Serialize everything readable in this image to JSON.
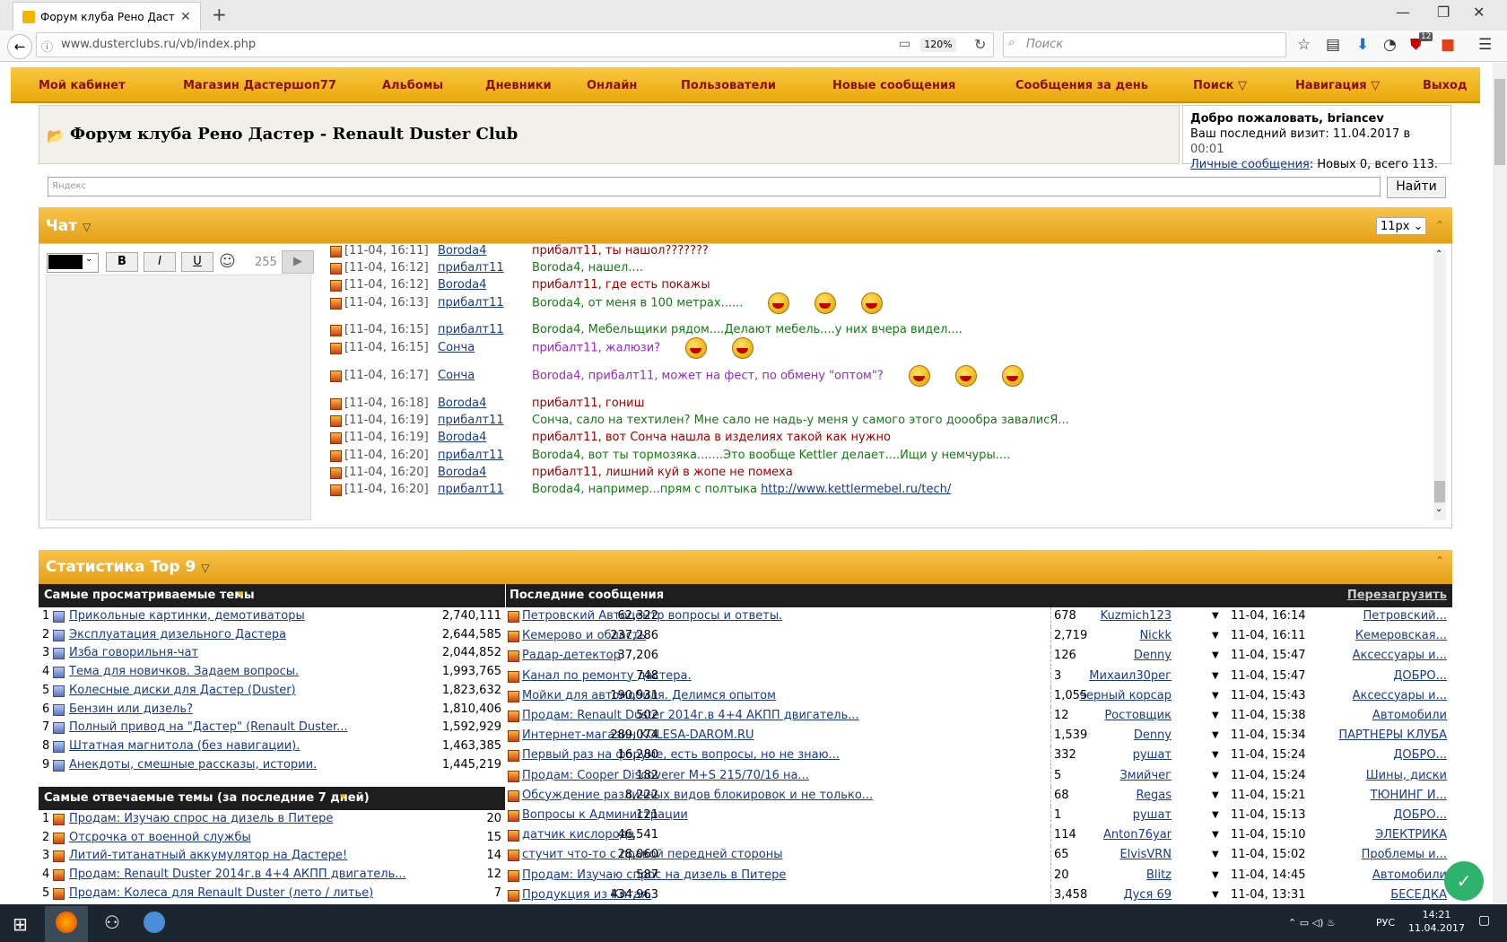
{
  "browser": {
    "tab_title": "Форум клуба Рено Дастер",
    "url": "www.dusterclubs.ru/vb/index.php",
    "zoom": "120%",
    "search_placeholder": "Поиск",
    "badge": "12"
  },
  "nav": {
    "items": [
      "Мой кабинет",
      "Магазин Дастершоп77",
      "Альбомы",
      "Дневники",
      "Онлайн",
      "Пользователи",
      "Новые сообщения",
      "Сообщения за день",
      "Поиск",
      "Навигация",
      "Выход"
    ]
  },
  "header": {
    "forum_title": "Форум клуба Рено Дастер - Renault Duster Club",
    "welcome_line": "Добро пожаловать, briancev",
    "last_visit_label": "Ваш последний визит: 11.04.2017 в",
    "last_visit_time": "00:01",
    "pm_link": "Личные сообщения",
    "pm_status": ": Новых 0, всего 113."
  },
  "search": {
    "placeholder": "Яндекс",
    "button": "Найти"
  },
  "chat": {
    "title": "Чат",
    "font_size": "11px",
    "char_count": "255",
    "bold": "B",
    "italic": "I",
    "underline": "U",
    "messages": [
      {
        "ts": "[11-04, 16:11]",
        "user": "Boroda4",
        "text": "прибалт11, ты нашол???????",
        "color": "#a00000",
        "smiles": 0
      },
      {
        "ts": "[11-04, 16:12]",
        "user": "прибалт11",
        "text": "Boroda4, нашел....",
        "color": "#157a15",
        "smiles": 0
      },
      {
        "ts": "[11-04, 16:12]",
        "user": "Boroda4",
        "text": "прибалт11, где есть покажы",
        "color": "#a00000",
        "smiles": 0
      },
      {
        "ts": "[11-04, 16:13]",
        "user": "прибалт11",
        "text": "Boroda4, от меня в 100 метрах......",
        "color": "#157a15",
        "smiles": 3
      },
      {
        "ts": "[11-04, 16:15]",
        "user": "прибалт11",
        "text": "Boroda4, Мебельщики рядом....Делают мебель....у них вчера видел....",
        "color": "#157a15",
        "smiles": 0
      },
      {
        "ts": "[11-04, 16:15]",
        "user": "Сонча",
        "text": "прибалт11, жалюзи?",
        "color": "#9a28c8",
        "smiles": 2
      },
      {
        "ts": "[11-04, 16:17]",
        "user": "Сонча",
        "text": "Boroda4, прибалт11, может на фест, по обмену \"оптом\"?",
        "color": "#9a28c8",
        "smiles": 3
      },
      {
        "ts": "[11-04, 16:18]",
        "user": "Boroda4",
        "text": "прибалт11, гониш",
        "color": "#a00000",
        "smiles": 0
      },
      {
        "ts": "[11-04, 16:19]",
        "user": "прибалт11",
        "text": "Сонча, сало на техтилен? Мне сало не надь-у меня у самого этого доообра завалисЯ...",
        "color": "#157a15",
        "smiles": 0
      },
      {
        "ts": "[11-04, 16:19]",
        "user": "Boroda4",
        "text": "прибалт11, вот Сонча нашла в изделиях такой как нужно",
        "color": "#a00000",
        "smiles": 0
      },
      {
        "ts": "[11-04, 16:20]",
        "user": "прибалт11",
        "text": "Boroda4, вот ты тормозяка.......Это вообще Kettler делает....Ищи у немчуры....",
        "color": "#157a15",
        "smiles": 0
      },
      {
        "ts": "[11-04, 16:20]",
        "user": "Boroda4",
        "text": "прибалт11, лишний куй в жопе не помеха",
        "color": "#a00000",
        "smiles": 0
      },
      {
        "ts": "[11-04, 16:20]",
        "user": "прибалт11",
        "text": "Boroda4, например...прям с полтыка ",
        "link": "http://www.kettlermebel.ru/tech/",
        "color": "#157a15",
        "smiles": 0
      }
    ]
  },
  "stats": {
    "title": "Статистика Top 9",
    "most_viewed_title": "Самые просматриваемые темы",
    "most_viewed": [
      {
        "n": "1",
        "title": "Прикольные картинки, демотиваторы",
        "views": "2,740,111"
      },
      {
        "n": "2",
        "title": "Эксплуатация дизельного Дастера",
        "views": "2,644,585"
      },
      {
        "n": "3",
        "title": "Изба говорильня-чат",
        "views": "2,044,852"
      },
      {
        "n": "4",
        "title": "Тема для новичков. Задаем вопросы.",
        "views": "1,993,765"
      },
      {
        "n": "5",
        "title": "Колесные диски для Дастер (Duster)",
        "views": "1,823,632"
      },
      {
        "n": "6",
        "title": "Бензин или дизель?",
        "views": "1,810,406"
      },
      {
        "n": "7",
        "title": "Полный привод на \"Дастер\" (Renault Duster...",
        "views": "1,592,929"
      },
      {
        "n": "8",
        "title": "Штатная магнитола (без навигации).",
        "views": "1,463,385"
      },
      {
        "n": "9",
        "title": "Анекдоты, смешные рассказы, истории.",
        "views": "1,445,219"
      }
    ],
    "most_replied_title": "Самые отвечаемые темы (за последние 7 дней)",
    "most_replied": [
      {
        "n": "1",
        "title": "Продам: Изучаю спрос на дизель в Питере",
        "count": "20"
      },
      {
        "n": "2",
        "title": "Отсрочка от военной службы",
        "count": "15"
      },
      {
        "n": "3",
        "title": "Литий-титанатный аккумулятор на Дастере!",
        "count": "14"
      },
      {
        "n": "4",
        "title": "Продам: Renault Duster 2014г.в 4+4 АКПП двигатель...",
        "count": "12"
      },
      {
        "n": "5",
        "title": "Продам: Колеса для Renault Duster (лето / литье)",
        "count": "7"
      }
    ],
    "latest_title": "Последние сообщения",
    "reload": "Перезагрузить",
    "latest": [
      {
        "title": "Петровский Автоцентр вопросы и ответы.",
        "views": "62,322",
        "replies": "678",
        "user": "Kuzmich123",
        "time": "11-04, 16:14",
        "forum": "Петровский..."
      },
      {
        "title": "Кемерово и область",
        "views": "237,286",
        "replies": "2,719",
        "user": "Nickk",
        "time": "11-04, 16:11",
        "forum": "Кемеровская..."
      },
      {
        "title": "Радар-детектор",
        "views": "37,206",
        "replies": "126",
        "user": "Denny",
        "time": "11-04, 15:47",
        "forum": "Аксессуары и..."
      },
      {
        "title": "Канал по ремонту дастера.",
        "views": "748",
        "replies": "3",
        "user": "Михаил30рег",
        "time": "11-04, 15:47",
        "forum": "ДОБРО..."
      },
      {
        "title": "Мойки для автомобиля. Делимся опытом",
        "views": "190,931",
        "replies": "1,055",
        "user": "черный корсар",
        "time": "11-04, 15:43",
        "forum": "Аксессуары и..."
      },
      {
        "title": "Продам: Renault Duster 2014г.в 4+4 АКПП двигатель...",
        "views": "502",
        "replies": "12",
        "user": "Ростовщик",
        "time": "11-04, 15:38",
        "forum": "Автомобили"
      },
      {
        "title": "Интернет-магазин KOLESA-DAROM.RU",
        "views": "289,074",
        "replies": "1,539",
        "user": "Denny",
        "time": "11-04, 15:34",
        "forum": "ПАРТНЕРЫ КЛУБА"
      },
      {
        "title": "Первый раз на форуме, есть вопросы, но не знаю...",
        "views": "16,280",
        "replies": "332",
        "user": "рушат",
        "time": "11-04, 15:24",
        "forum": "ДОБРО..."
      },
      {
        "title": "Продам: Cooper Discoverer M+S 215/70/16 на...",
        "views": "182",
        "replies": "5",
        "user": "Змийчег",
        "time": "11-04, 15:24",
        "forum": "Шины, диски"
      },
      {
        "title": "Обсуждение различных видов блокировок и не только...",
        "views": "8,222",
        "replies": "68",
        "user": "Regas",
        "time": "11-04, 15:21",
        "forum": "ТЮНИНГ И..."
      },
      {
        "title": "Вопросы к Администрации",
        "views": "121",
        "replies": "1",
        "user": "рушат",
        "time": "11-04, 15:13",
        "forum": "ДОБРО..."
      },
      {
        "title": "датчик кислорода",
        "views": "46,541",
        "replies": "114",
        "user": "Anton76yar",
        "time": "11-04, 15:10",
        "forum": "ЭЛЕКТРИКА"
      },
      {
        "title": "стучит что-то с правой передней стороны",
        "views": "28,060",
        "replies": "65",
        "user": "ElvisVRN",
        "time": "11-04, 15:02",
        "forum": "Проблемы и..."
      },
      {
        "title": "Продам: Изучаю спрос на дизель в Питере",
        "views": "587",
        "replies": "20",
        "user": "Blitz",
        "time": "11-04, 14:45",
        "forum": "Автомобили"
      },
      {
        "title": "Продукция из Китая.",
        "views": "434,963",
        "replies": "3,458",
        "user": "Дуся 69",
        "time": "11-04, 13:31",
        "forum": "БЕСЕДКА"
      }
    ]
  },
  "taskbar": {
    "time": "14:21",
    "date": "11.04.2017",
    "lang": "РУС"
  },
  "colors": {
    "accent": "#f2b600",
    "nav_text": "#8a0f0f",
    "link": "#1a3a8a"
  }
}
